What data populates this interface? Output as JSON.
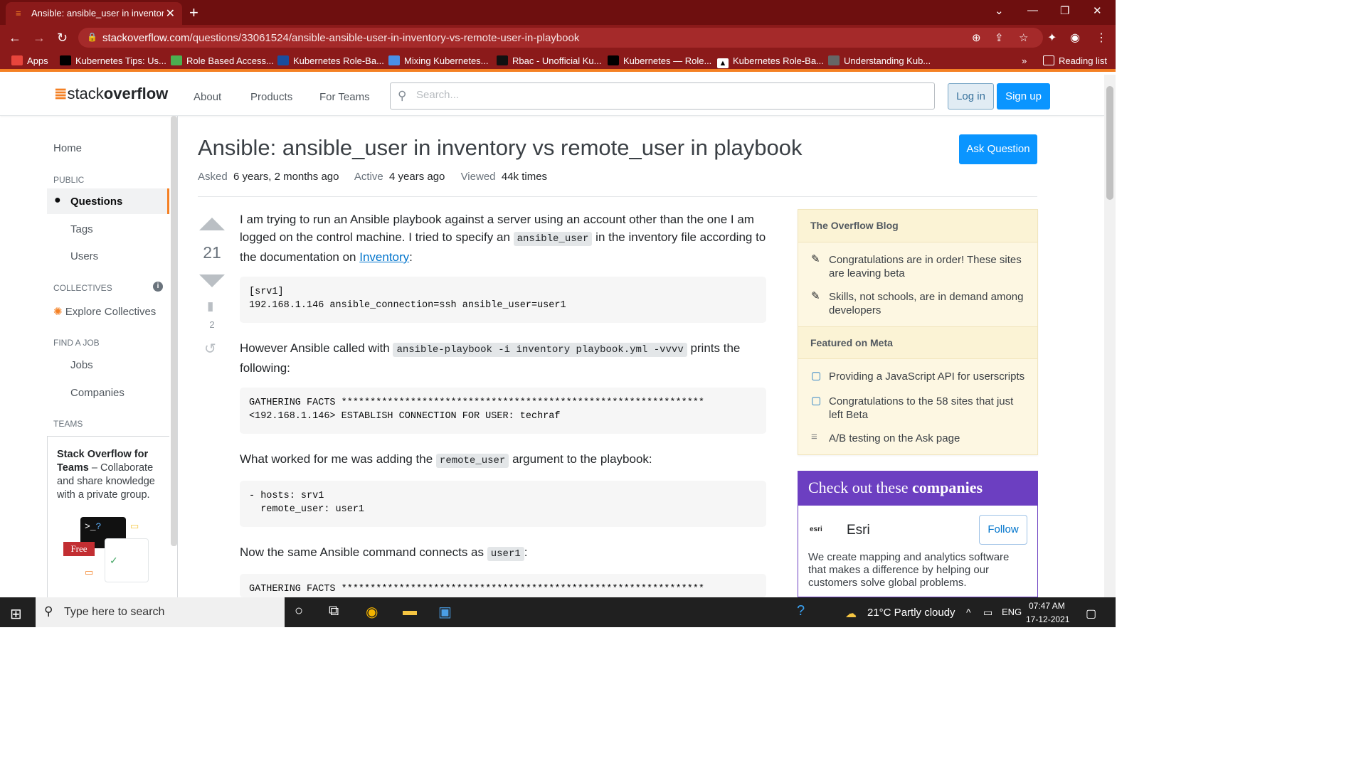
{
  "browser": {
    "tab_title": "Ansible: ansible_user in inventory",
    "url_domain": "stackoverflow.com",
    "url_path": "/questions/33061524/ansible-ansible-user-in-inventory-vs-remote-user-in-playbook",
    "bookmarks": [
      "Apps",
      "Kubernetes Tips: Us...",
      "Role Based Access...",
      "Kubernetes Role-Ba...",
      "Mixing Kubernetes...",
      "Rbac - Unofficial Ku...",
      "Kubernetes — Role...",
      "Kubernetes Role-Ba...",
      "Understanding Kub..."
    ],
    "reading_list": "Reading list"
  },
  "header": {
    "logo_stack": "stack",
    "logo_overflow": "overflow",
    "nav": [
      "About",
      "Products",
      "For Teams"
    ],
    "search_placeholder": "Search...",
    "login": "Log in",
    "signup": "Sign up"
  },
  "leftnav": {
    "home": "Home",
    "public": "PUBLIC",
    "questions": "Questions",
    "tags": "Tags",
    "users": "Users",
    "collectives": "COLLECTIVES",
    "explore": "Explore Collectives",
    "find_job": "FIND A JOB",
    "jobs": "Jobs",
    "companies": "Companies",
    "teams": "TEAMS",
    "teams_title": "Stack Overflow for Teams",
    "teams_desc": " – Collaborate and share knowledge with a private group.",
    "free": "Free"
  },
  "question": {
    "title": "Ansible: ansible_user in inventory vs remote_user in playbook",
    "ask_button": "Ask Question",
    "asked_label": "Asked",
    "asked_value": "6 years, 2 months ago",
    "active_label": "Active",
    "active_value": "4 years ago",
    "viewed_label": "Viewed",
    "viewed_value": "44k times",
    "score": "21",
    "bookmark_count": "2",
    "p1a": "I am trying to run an Ansible playbook against a server using an account other than the one I am logged on the control machine. I tried to specify an ",
    "p1code": "ansible_user",
    "p1b": " in the inventory file according to the documentation on ",
    "p1link": "Inventory",
    "p1c": ":",
    "code1": "[srv1]\n192.168.1.146 ansible_connection=ssh ansible_user=user1",
    "p2a": "However Ansible called with ",
    "p2code": "ansible-playbook -i inventory playbook.yml -vvvv",
    "p2b": " prints the following:",
    "code2": "GATHERING FACTS ***************************************************************\n<192.168.1.146> ESTABLISH CONNECTION FOR USER: techraf",
    "p3a": "What worked for me was adding the ",
    "p3code": "remote_user",
    "p3b": " argument to the playbook:",
    "code3": "- hosts: srv1\n  remote_user: user1",
    "p4a": "Now the same Ansible command connects as ",
    "p4code": "user1",
    "p4b": ":",
    "code4": "GATHERING FACTS ***************************************************************"
  },
  "sidebar": {
    "blog_title": "The Overflow Blog",
    "blog_items": [
      "Congratulations are in order! These sites are leaving beta",
      "Skills, not schools, are in demand among developers"
    ],
    "meta_title": "Featured on Meta",
    "meta_items": [
      "Providing a JavaScript API for userscripts",
      "Congratulations to the 58 sites that just left Beta",
      "A/B testing on the Ask page"
    ],
    "companies_title_a": "Check out these ",
    "companies_title_b": "companies",
    "company_logo": "esri",
    "company_name": "Esri",
    "follow": "Follow",
    "company_desc": "We create mapping and analytics software that makes a difference by helping our customers solve global problems."
  },
  "taskbar": {
    "search_placeholder": "Type here to search",
    "weather": "21°C  Partly cloudy",
    "lang": "ENG",
    "time": "07:47 AM",
    "date": "17-12-2021"
  }
}
